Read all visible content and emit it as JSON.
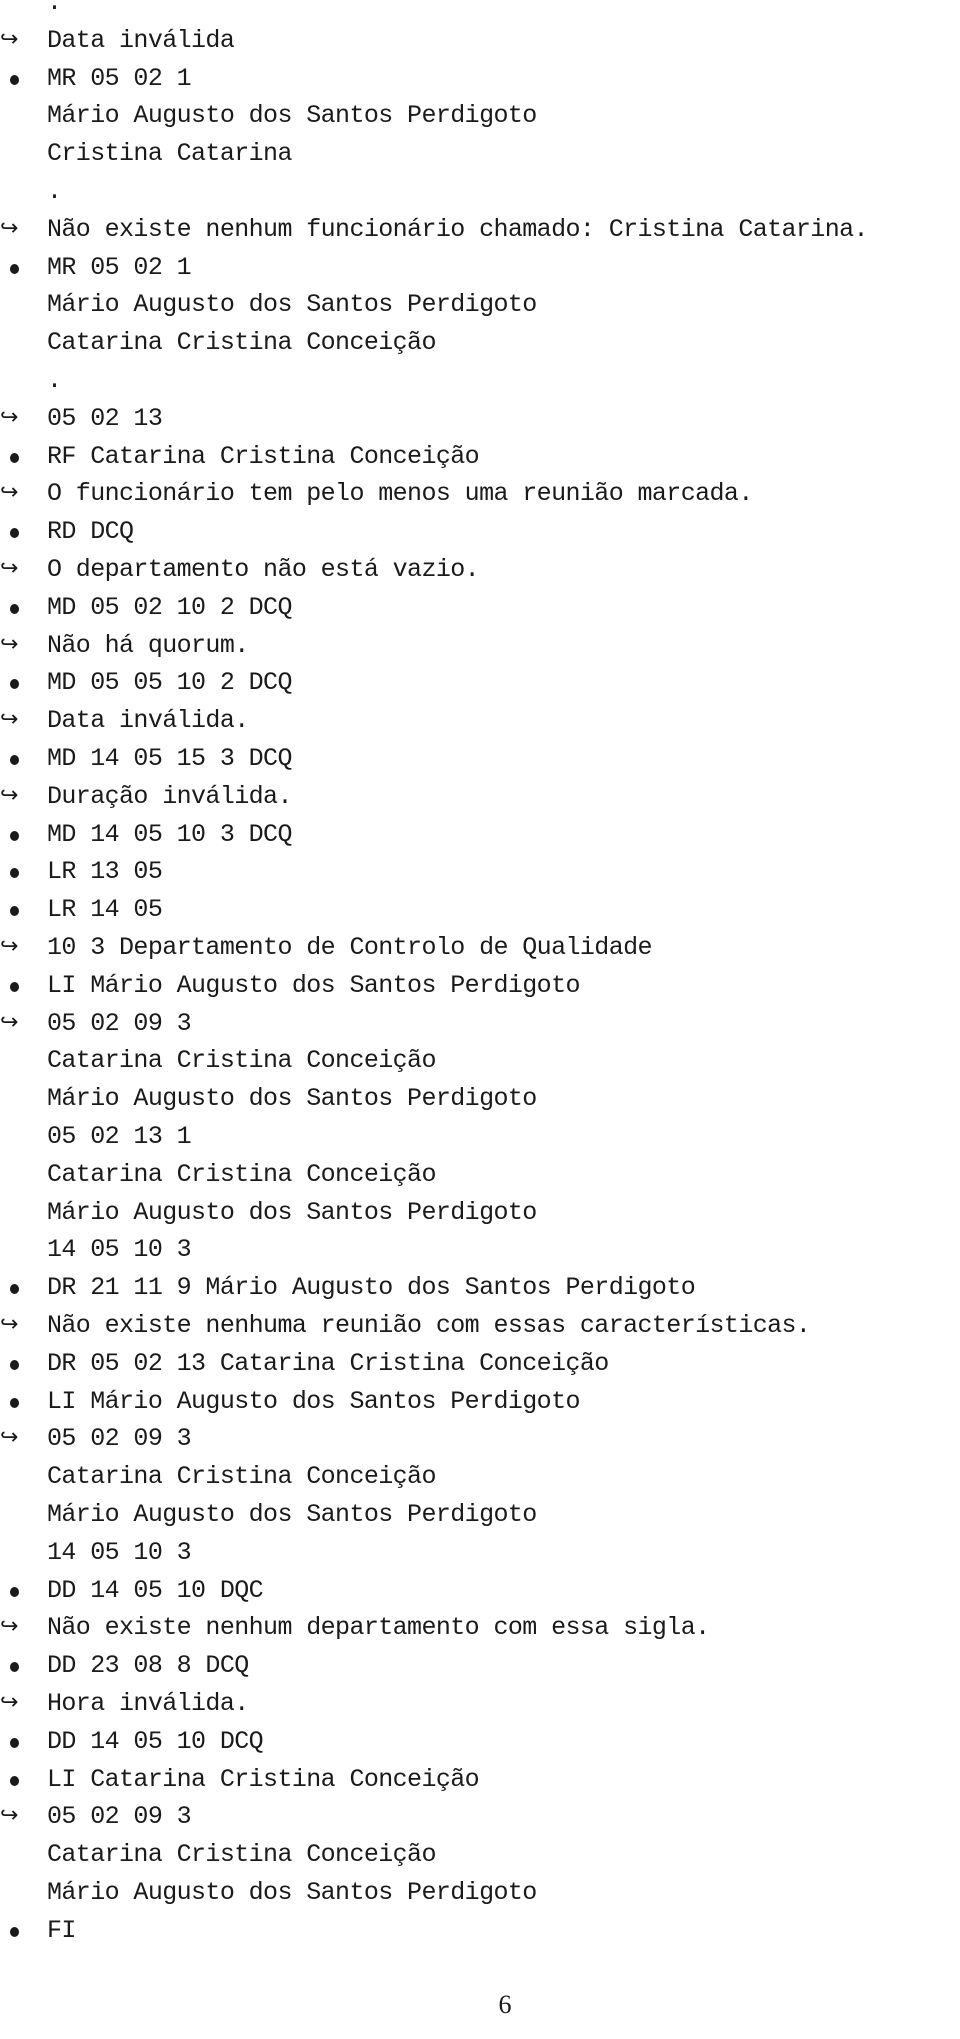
{
  "document": {
    "lines": [
      {
        "type": "plain",
        "text": "."
      },
      {
        "type": "output",
        "text": "Data inválida"
      },
      {
        "type": "input",
        "text": "MR 05 02 1"
      },
      {
        "type": "plain",
        "text": "Mário Augusto dos Santos Perdigoto"
      },
      {
        "type": "plain",
        "text": "Cristina Catarina"
      },
      {
        "type": "plain",
        "text": "."
      },
      {
        "type": "output",
        "text": "Não existe nenhum funcionário chamado: Cristina Catarina."
      },
      {
        "type": "input",
        "text": "MR 05 02 1"
      },
      {
        "type": "plain",
        "text": "Mário Augusto dos Santos Perdigoto"
      },
      {
        "type": "plain",
        "text": "Catarina Cristina Conceição"
      },
      {
        "type": "plain",
        "text": "."
      },
      {
        "type": "output",
        "text": "05 02 13"
      },
      {
        "type": "input",
        "text": "RF Catarina Cristina Conceição"
      },
      {
        "type": "output",
        "text": "O funcionário tem pelo menos uma reunião marcada."
      },
      {
        "type": "input",
        "text": "RD DCQ"
      },
      {
        "type": "output",
        "text": "O departamento não está vazio."
      },
      {
        "type": "input",
        "text": "MD 05 02 10 2 DCQ"
      },
      {
        "type": "output",
        "text": "Não há quorum."
      },
      {
        "type": "input",
        "text": "MD 05 05 10 2 DCQ"
      },
      {
        "type": "output",
        "text": "Data inválida."
      },
      {
        "type": "input",
        "text": "MD 14 05 15 3 DCQ"
      },
      {
        "type": "output",
        "text": "Duração inválida."
      },
      {
        "type": "input",
        "text": "MD 14 05 10 3 DCQ"
      },
      {
        "type": "input",
        "text": "LR 13 05"
      },
      {
        "type": "input",
        "text": "LR 14 05"
      },
      {
        "type": "output",
        "text": "10 3 Departamento de Controlo de Qualidade"
      },
      {
        "type": "input",
        "text": "LI Mário Augusto dos Santos Perdigoto"
      },
      {
        "type": "output",
        "text": "05 02 09 3"
      },
      {
        "type": "plain",
        "text": "Catarina Cristina Conceição"
      },
      {
        "type": "plain",
        "text": "Mário Augusto dos Santos Perdigoto"
      },
      {
        "type": "plain",
        "text": "05 02 13 1"
      },
      {
        "type": "plain",
        "text": "Catarina Cristina Conceição"
      },
      {
        "type": "plain",
        "text": "Mário Augusto dos Santos Perdigoto"
      },
      {
        "type": "plain",
        "text": "14 05 10 3"
      },
      {
        "type": "input",
        "text": "DR 21 11 9 Mário Augusto dos Santos Perdigoto"
      },
      {
        "type": "output",
        "text": "Não existe nenhuma reunião com essas características."
      },
      {
        "type": "input",
        "text": "DR 05 02 13 Catarina Cristina Conceição"
      },
      {
        "type": "input",
        "text": "LI Mário Augusto dos Santos Perdigoto"
      },
      {
        "type": "output",
        "text": "05 02 09 3"
      },
      {
        "type": "plain",
        "text": "Catarina Cristina Conceição"
      },
      {
        "type": "plain",
        "text": "Mário Augusto dos Santos Perdigoto"
      },
      {
        "type": "plain",
        "text": "14 05 10 3"
      },
      {
        "type": "input",
        "text": "DD 14 05 10 DQC"
      },
      {
        "type": "output",
        "text": "Não existe nenhum departamento com essa sigla."
      },
      {
        "type": "input",
        "text": "DD 23 08 8 DCQ"
      },
      {
        "type": "output",
        "text": "Hora inválida."
      },
      {
        "type": "input",
        "text": "DD 14 05 10 DCQ"
      },
      {
        "type": "input",
        "text": "LI Catarina Cristina Conceição"
      },
      {
        "type": "output",
        "text": "05 02 09 3"
      },
      {
        "type": "plain",
        "text": "Catarina Cristina Conceição"
      },
      {
        "type": "plain",
        "text": "Mário Augusto dos Santos Perdigoto"
      },
      {
        "type": "input",
        "text": "FI"
      }
    ],
    "arrow_glyph": "↪",
    "page_number": "6"
  }
}
